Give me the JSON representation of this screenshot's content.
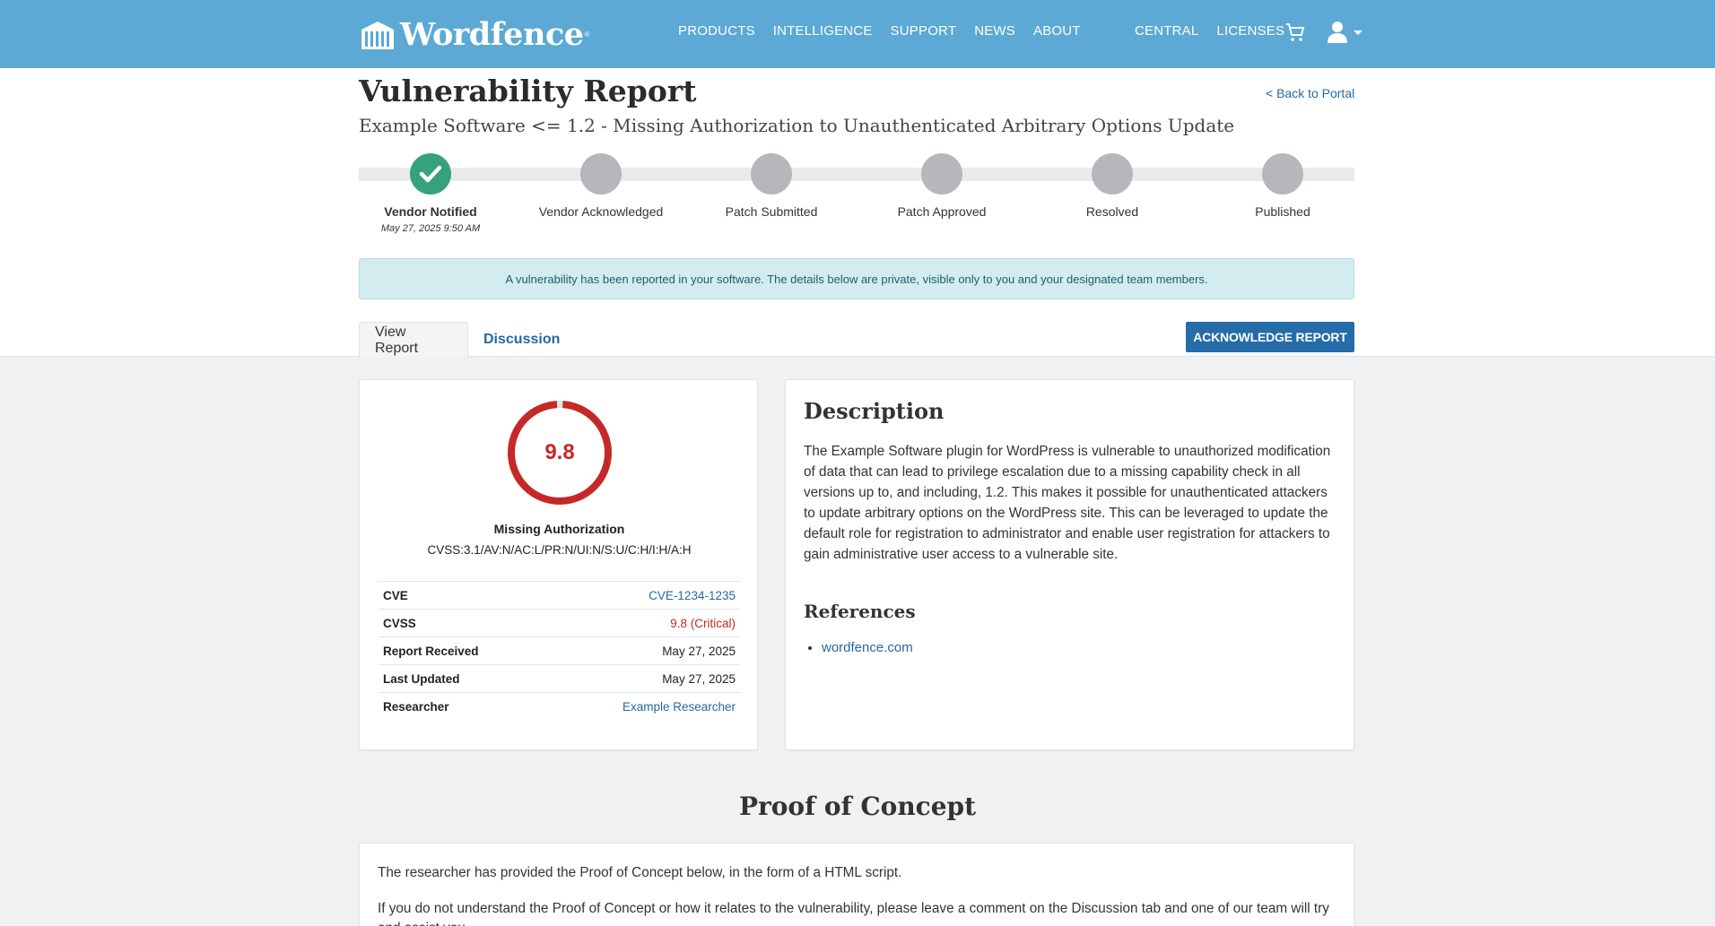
{
  "nav": {
    "logo_text": "Wordfence",
    "logo_reg": "®",
    "main_links": [
      "PRODUCTS",
      "INTELLIGENCE",
      "SUPPORT",
      "NEWS",
      "ABOUT"
    ],
    "right_links": [
      "CENTRAL",
      "LICENSES"
    ],
    "cart_icon": "cart-icon",
    "user_icon": "user-icon"
  },
  "header": {
    "title": "Vulnerability Report",
    "subtitle": "Example Software <= 1.2 - Missing Authorization to Unauthenticated Arbitrary Options Update",
    "back_link": "< Back to Portal"
  },
  "progress": {
    "steps": [
      {
        "label": "Vendor Notified",
        "date": "May 27, 2025 9:50 AM",
        "done": true
      },
      {
        "label": "Vendor Acknowledged",
        "done": false
      },
      {
        "label": "Patch Submitted",
        "done": false
      },
      {
        "label": "Patch Approved",
        "done": false
      },
      {
        "label": "Resolved",
        "done": false
      },
      {
        "label": "Published",
        "done": false
      }
    ]
  },
  "alert": {
    "text": "A vulnerability has been reported in your software. The details below are private, visible only to you and your designated team members."
  },
  "tabs": {
    "view_report": "View Report",
    "discussion": "Discussion"
  },
  "actions": {
    "acknowledge": "Acknowledge Report"
  },
  "score": {
    "value": "9.8",
    "fraction": 0.98,
    "color": "#c62828",
    "vuln_type": "Missing Authorization",
    "vector": "CVSS:3.1/AV:N/AC:L/PR:N/UI:N/S:U/C:H/I:H/A:H"
  },
  "info": {
    "cve_label": "CVE",
    "cve_value": "CVE-1234-1235",
    "cvss_label": "CVSS",
    "cvss_value": "9.8 (Critical)",
    "received_label": "Report Received",
    "received_value": "May 27, 2025",
    "updated_label": "Last Updated",
    "updated_value": "May 27, 2025",
    "researcher_label": "Researcher",
    "researcher_value": "Example Researcher"
  },
  "description": {
    "title": "Description",
    "body": "The Example Software plugin for WordPress is vulnerable to unauthorized modification of data that can lead to privilege escalation due to a missing capability check in all versions up to, and including, 1.2. This makes it possible for unauthenticated attackers to update arbitrary options on the WordPress site. This can be leveraged to update the default role for registration to administrator and enable user registration for attackers to gain administrative user access to a vulnerable site.",
    "references_title": "References",
    "references": [
      "wordfence.com"
    ]
  },
  "poc": {
    "title": "Proof of Concept",
    "p1": "The researcher has provided the Proof of Concept below, in the form of a HTML script.",
    "p2": "If you do not understand the Proof of Concept or how it relates to the vulnerability, please leave a comment on the Discussion tab and one of our team will try and assist you."
  }
}
